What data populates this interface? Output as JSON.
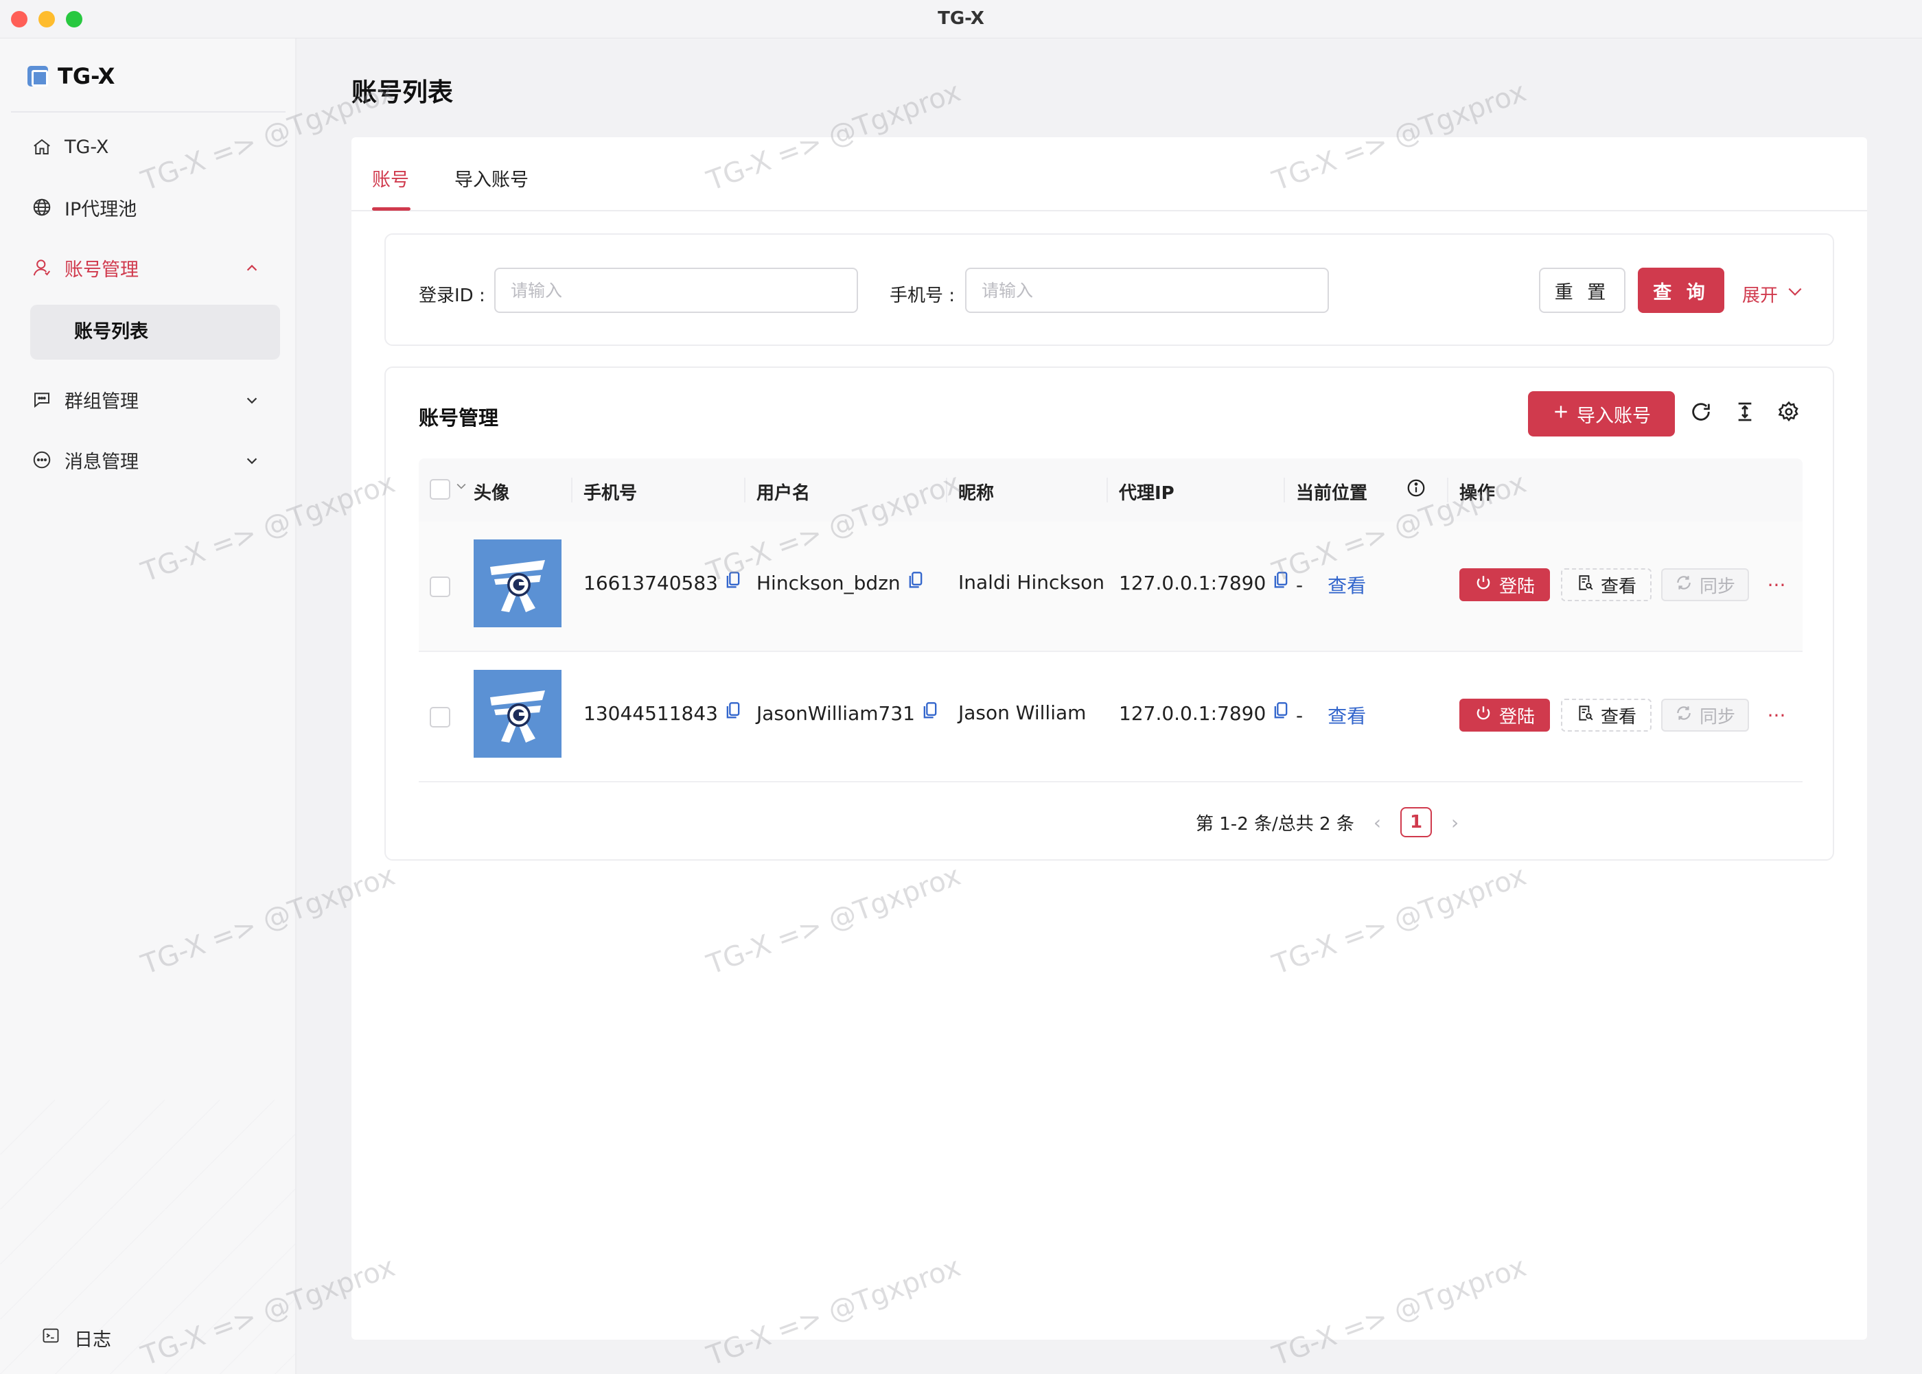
{
  "window": {
    "title": "TG-X"
  },
  "sidebar": {
    "logo_text": "TG-X",
    "items": [
      {
        "label": "TG-X",
        "icon": "home-icon"
      },
      {
        "label": "IP代理池",
        "icon": "globe-icon"
      },
      {
        "label": "账号管理",
        "icon": "user-icon",
        "expanded": true
      },
      {
        "label": "群组管理",
        "icon": "chat-group-icon"
      },
      {
        "label": "消息管理",
        "icon": "message-icon"
      }
    ],
    "subitem_active": "账号列表",
    "logs_label": "日志"
  },
  "page": {
    "title": "账号列表"
  },
  "tabs": [
    {
      "label": "账号",
      "active": true
    },
    {
      "label": "导入账号"
    }
  ],
  "search": {
    "login_id_label": "登录ID :",
    "login_id_placeholder": "请输入",
    "phone_label": "手机号 :",
    "phone_placeholder": "请输入",
    "reset_label": "重 置",
    "query_label": "查 询",
    "expand_label": "展开"
  },
  "table_card": {
    "title": "账号管理",
    "import_label": "导入账号",
    "columns": [
      "头像",
      "手机号",
      "用户名",
      "昵称",
      "代理IP",
      "当前位置",
      "操作"
    ],
    "rows": [
      {
        "phone": "16613740583",
        "username": "Hinckson_bdzn",
        "nickname": "Inaldi Hinckson",
        "proxy": "127.0.0.1:7890",
        "location": "-",
        "location_link": "查看",
        "login": "登陆",
        "view": "查看",
        "sync": "同步",
        "more": "···"
      },
      {
        "phone": "13044511843",
        "username": "JasonWilliam731",
        "nickname": "Jason William",
        "proxy": "127.0.0.1:7890",
        "location": "-",
        "location_link": "查看",
        "login": "登陆",
        "view": "查看",
        "sync": "同步",
        "more": "···"
      }
    ],
    "pagination": {
      "summary": "第 1-2 条/总共 2 条",
      "current_page": "1"
    }
  },
  "watermark": "TG-X => @Tgxprox",
  "colors": {
    "accent": "#d03a4d",
    "link": "#3366cc",
    "avatar_bg": "#5b91d4"
  }
}
